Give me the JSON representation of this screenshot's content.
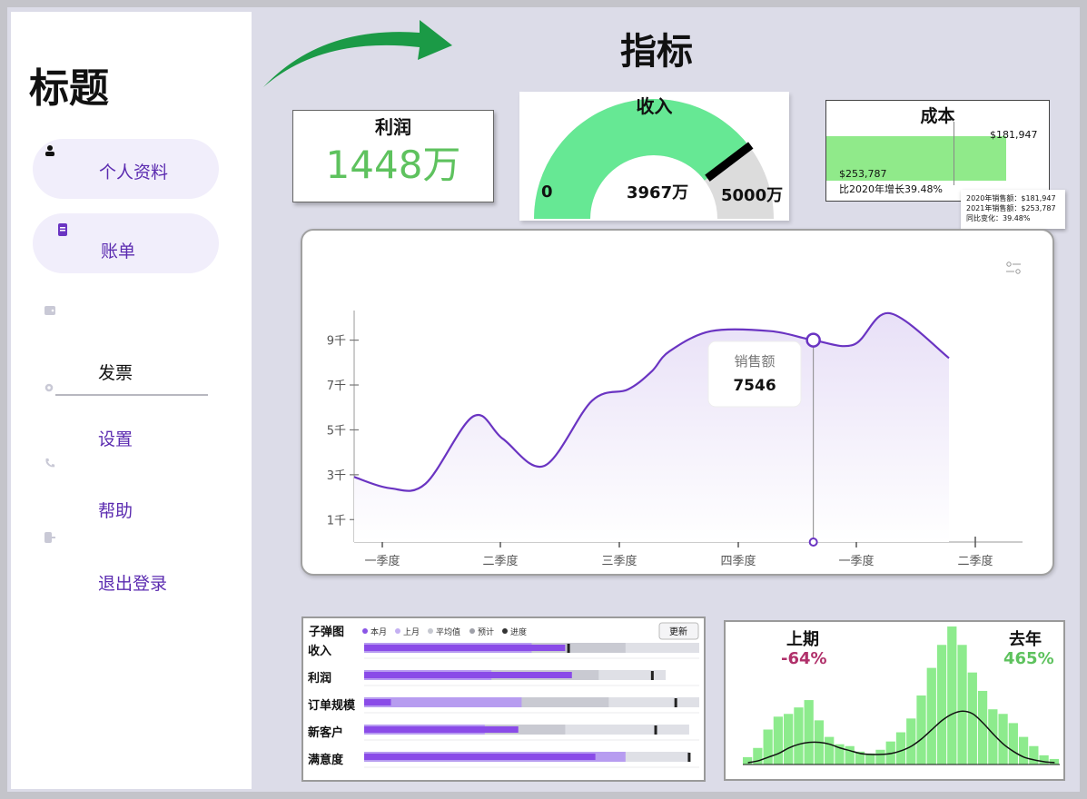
{
  "sidebar": {
    "title": "标题",
    "items": [
      {
        "label": "个人资料",
        "icon": "person-icon"
      },
      {
        "label": "账单",
        "icon": "bill-icon"
      },
      {
        "label": "发票",
        "icon": "wallet-icon"
      },
      {
        "label": "设置",
        "icon": "gear-icon"
      },
      {
        "label": "帮助",
        "icon": "phone-icon"
      },
      {
        "label": "退出登录",
        "icon": "logout-icon"
      }
    ]
  },
  "main": {
    "title": "指标"
  },
  "profit": {
    "label": "利润",
    "value": "1448万"
  },
  "revenue": {
    "label": "收入",
    "min": "0",
    "value": "3967万",
    "max": "5000万",
    "value_num": 3967,
    "max_num": 5000
  },
  "cost": {
    "label": "成本",
    "value_2020": "$181,947",
    "value_2021": "$253,787",
    "growth": "比2020年增长39.48%",
    "tooltip": [
      "2020年销售额：$181,947",
      "2021年销售额：$253,787",
      "同比变化：39.48%"
    ]
  },
  "colors": {
    "accent": "#6a34c2",
    "green": "#5ec25e",
    "gauge_green": "#66e894",
    "bar_green": "#90ea8a",
    "negative": "#b0306a"
  },
  "chart_data": [
    {
      "type": "line",
      "categories": [
        "一季度",
        "二季度",
        "三季度",
        "四季度",
        "一季度",
        "二季度"
      ],
      "x": [
        0.0,
        0.3,
        0.6,
        1.0,
        1.25,
        1.6,
        2.0,
        2.3,
        2.5,
        2.65,
        3.0,
        3.5,
        3.86,
        4.2,
        4.5,
        5.0
      ],
      "y": [
        2900,
        2400,
        2600,
        5600,
        4600,
        3400,
        6300,
        6800,
        7600,
        8500,
        9400,
        9400,
        9000,
        8800,
        10200,
        8200
      ],
      "ylim": [
        0,
        10400
      ],
      "yticks": [
        "1千",
        "3千",
        "5千",
        "7千",
        "9千"
      ],
      "ytick_values": [
        1000,
        3000,
        5000,
        7000,
        9000
      ],
      "tooltip": {
        "label": "销售额",
        "value": "7546"
      },
      "highlight_x": 3.86,
      "settings_icon": "sliders-icon"
    },
    {
      "type": "bar",
      "subtype": "bullet",
      "title": "子弹图",
      "legend": [
        "本月",
        "上月",
        "平均值",
        "预计",
        "进度"
      ],
      "update_label": "更新",
      "categories": [
        "收入",
        "利润",
        "订单规模",
        "新客户",
        "满意度"
      ],
      "current": [
        0.6,
        0.62,
        0.08,
        0.46,
        0.69
      ],
      "last": [
        0.5,
        0.38,
        0.47,
        0.36,
        0.78
      ],
      "avg": [
        0.78,
        0.7,
        0.73,
        0.6,
        0.74
      ],
      "forecast": [
        1.0,
        0.9,
        1.0,
        0.97,
        0.97
      ],
      "progress": [
        0.61,
        0.86,
        0.93,
        0.87,
        0.97
      ]
    },
    {
      "type": "histogram",
      "left_label": "上期",
      "left_value": "-64%",
      "right_label": "去年",
      "right_value": "465%",
      "values": [
        8,
        18,
        38,
        52,
        55,
        62,
        70,
        48,
        30,
        22,
        20,
        14,
        12,
        16,
        25,
        35,
        50,
        75,
        105,
        130,
        150,
        130,
        100,
        80,
        60,
        55,
        45,
        30,
        20,
        10,
        6
      ],
      "curve": [
        2,
        4,
        8,
        12,
        18,
        22,
        24,
        24,
        22,
        18,
        15,
        12,
        11,
        11,
        12,
        15,
        20,
        28,
        38,
        48,
        55,
        58,
        55,
        45,
        33,
        22,
        14,
        8,
        5,
        3,
        2
      ]
    }
  ]
}
